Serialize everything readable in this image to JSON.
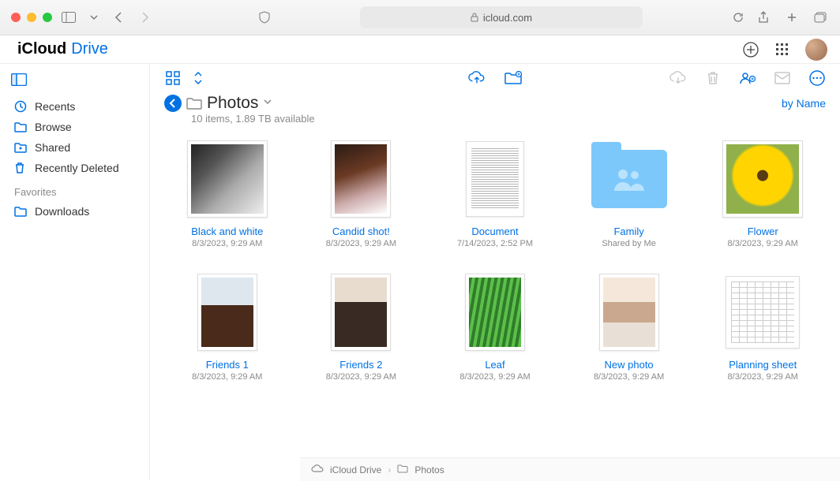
{
  "browser": {
    "address": "icloud.com"
  },
  "app": {
    "logo_icloud": "iCloud",
    "logo_drive": " Drive"
  },
  "sidebar": {
    "items": [
      {
        "label": "Recents"
      },
      {
        "label": "Browse"
      },
      {
        "label": "Shared"
      },
      {
        "label": "Recently Deleted"
      }
    ],
    "section": "Favorites",
    "favorites": [
      {
        "label": "Downloads"
      }
    ]
  },
  "title": {
    "folder": "Photos",
    "subtitle": "10 items, 1.89 TB available",
    "sort": "by Name"
  },
  "items": [
    {
      "name": "Black and white",
      "meta": "8/3/2023, 9:29 AM",
      "kind": "image",
      "imgclass": "img-bw"
    },
    {
      "name": "Candid shot!",
      "meta": "8/3/2023, 9:29 AM",
      "kind": "image",
      "imgclass": "img-candid"
    },
    {
      "name": "Document",
      "meta": "7/14/2023, 2:52 PM",
      "kind": "doc"
    },
    {
      "name": "Family",
      "meta": "Shared by Me",
      "kind": "folder"
    },
    {
      "name": "Flower",
      "meta": "8/3/2023, 9:29 AM",
      "kind": "image",
      "imgclass": "img-flower"
    },
    {
      "name": "Friends 1",
      "meta": "8/3/2023, 9:29 AM",
      "kind": "image",
      "imgclass": "img-friends1"
    },
    {
      "name": "Friends 2",
      "meta": "8/3/2023, 9:29 AM",
      "kind": "image",
      "imgclass": "img-friends2"
    },
    {
      "name": "Leaf",
      "meta": "8/3/2023, 9:29 AM",
      "kind": "image",
      "imgclass": "img-leaf"
    },
    {
      "name": "New photo",
      "meta": "8/3/2023, 9:29 AM",
      "kind": "image",
      "imgclass": "img-newphoto"
    },
    {
      "name": "Planning sheet",
      "meta": "8/3/2023, 9:29 AM",
      "kind": "sheet"
    }
  ],
  "breadcrumb": {
    "root": "iCloud Drive",
    "current": "Photos"
  }
}
